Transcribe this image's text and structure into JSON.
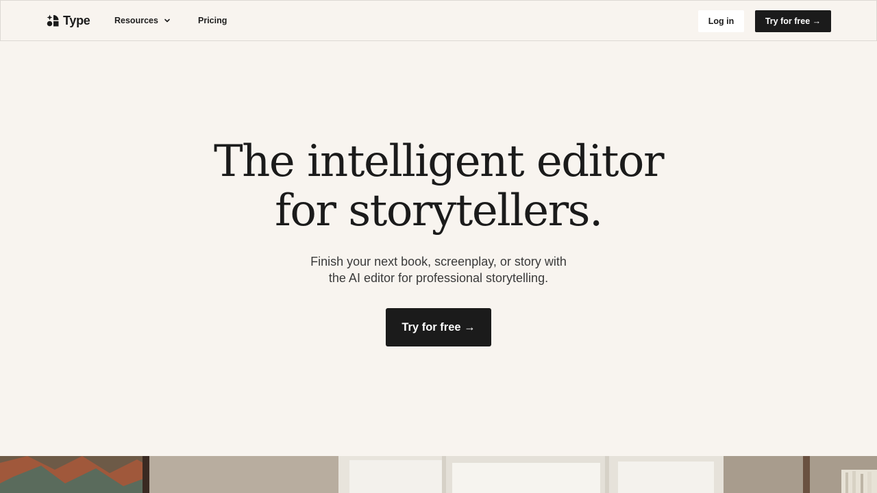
{
  "nav": {
    "brand": "Type",
    "resources_label": "Resources",
    "pricing_label": "Pricing",
    "login_label": "Log in",
    "cta_label": "Try for free →"
  },
  "hero": {
    "title_line1": "The intelligent editor",
    "title_line2": "for storytellers.",
    "subtitle_line1": "Finish your next book, screenplay, or story with",
    "subtitle_line2": "the AI editor for professional storytelling.",
    "cta_label": "Try for free →"
  },
  "icons": {
    "logo": "type-logo-mark",
    "resources_dropdown": "chevron-down-icon"
  },
  "colors": {
    "background": "#f8f4ef",
    "text": "#1b1b1b",
    "button_dark": "#1b1b1b",
    "button_light": "#ffffff",
    "subtitle": "#3a3a3a"
  }
}
